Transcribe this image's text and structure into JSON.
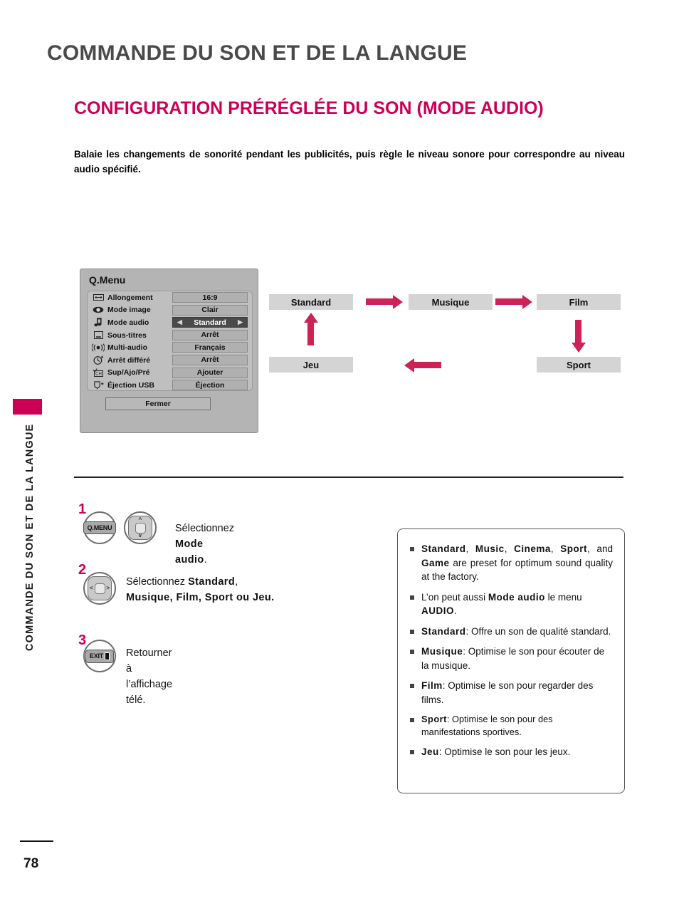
{
  "header": {
    "chapter_title": "COMMANDE DU SON ET DE LA LANGUE",
    "section_title": "CONFIGURATION PRÉRÉGLÉE DU SON (MODE AUDIO)",
    "intro": "Balaie les changements de sonorité pendant les publicités, puis règle le niveau sonore pour correspondre au niveau audio spécifié."
  },
  "sidebar": {
    "tab_label": "COMMANDE DU SON ET DE LA LANGUE"
  },
  "qmenu": {
    "title": "Q.Menu",
    "close_label": "Fermer",
    "left_arrow": "◀",
    "right_arrow": "▶",
    "rows": [
      {
        "icon": "aspect-ratio-icon",
        "label": "Allongement",
        "value": "16:9",
        "selected": false
      },
      {
        "icon": "eye-icon",
        "label": "Mode image",
        "value": "Clair",
        "selected": false
      },
      {
        "icon": "music-note-icon",
        "label": "Mode audio",
        "value": "Standard",
        "selected": true
      },
      {
        "icon": "caption-icon",
        "label": "Sous-titres",
        "value": "Arrêt",
        "selected": false
      },
      {
        "icon": "multi-audio-icon",
        "label": "Multi-audio",
        "value": "Français",
        "selected": false
      },
      {
        "icon": "sleep-timer-icon",
        "label": "Arrêt différé",
        "value": "Arrêt",
        "selected": false
      },
      {
        "icon": "channel-edit-icon",
        "label": "Sup/Ajo/Pré",
        "value": "Ajouter",
        "selected": false
      },
      {
        "icon": "usb-eject-icon",
        "label": "Éjection USB",
        "value": "Éjection",
        "selected": false
      }
    ]
  },
  "flow": {
    "accent_color": "#cc2255",
    "box_color": "#d4d4d4",
    "boxes": {
      "standard": "Standard",
      "musique": "Musique",
      "film": "Film",
      "sport": "Sport",
      "jeu": "Jeu"
    },
    "arrows": [
      {
        "name": "standard-to-musique",
        "direction": "right"
      },
      {
        "name": "musique-to-film",
        "direction": "right"
      },
      {
        "name": "film-to-sport",
        "direction": "down"
      },
      {
        "name": "sport-to-jeu",
        "direction": "left"
      },
      {
        "name": "jeu-to-standard",
        "direction": "up"
      }
    ]
  },
  "steps": [
    {
      "number": "1",
      "keys": [
        "Q.MENU",
        "nav-up-down"
      ],
      "key_label": "Q.MENU",
      "text_prefix": "Sélectionnez ",
      "text_bold": "Mode audio",
      "text_suffix": "."
    },
    {
      "number": "2",
      "keys": [
        "nav-left-right"
      ],
      "line1_prefix": "Sélectionnez ",
      "line1_bold": "Standard",
      "line1_suffix": ",",
      "line2": "Musique, Film, Sport ou Jeu."
    },
    {
      "number": "3",
      "key_label": "EXIT",
      "text": "Retourner à l’affichage télé."
    }
  ],
  "notes": [
    {
      "id": "note-presets",
      "html": "<b>Standard</b>, <b>Music</b>, <b>Cinema</b>, <b>Sport</b>, and <b>Game</b> are preset for optimum sound quality at the factory."
    },
    {
      "id": "note-audio-menu",
      "html": "L’on peut aussi <b>Mode audio</b> le menu <b>AUDIO</b>."
    },
    {
      "id": "note-standard",
      "html": "<b>Standard</b>: Offre un son de qualité standard."
    },
    {
      "id": "note-musique",
      "html": "<b>Musique</b>: Optimise le son pour écouter de la musique."
    },
    {
      "id": "note-film",
      "html": "<b>Film</b>: Optimise le son pour regarder des films."
    },
    {
      "id": "note-sport",
      "html": "<b>Sport</b>: Optimise le son pour des manifestations sportives."
    },
    {
      "id": "note-jeu",
      "html": "<b>Jeu</b>: Optimise le son pour les jeux."
    }
  ],
  "footer": {
    "page_number": "78"
  }
}
